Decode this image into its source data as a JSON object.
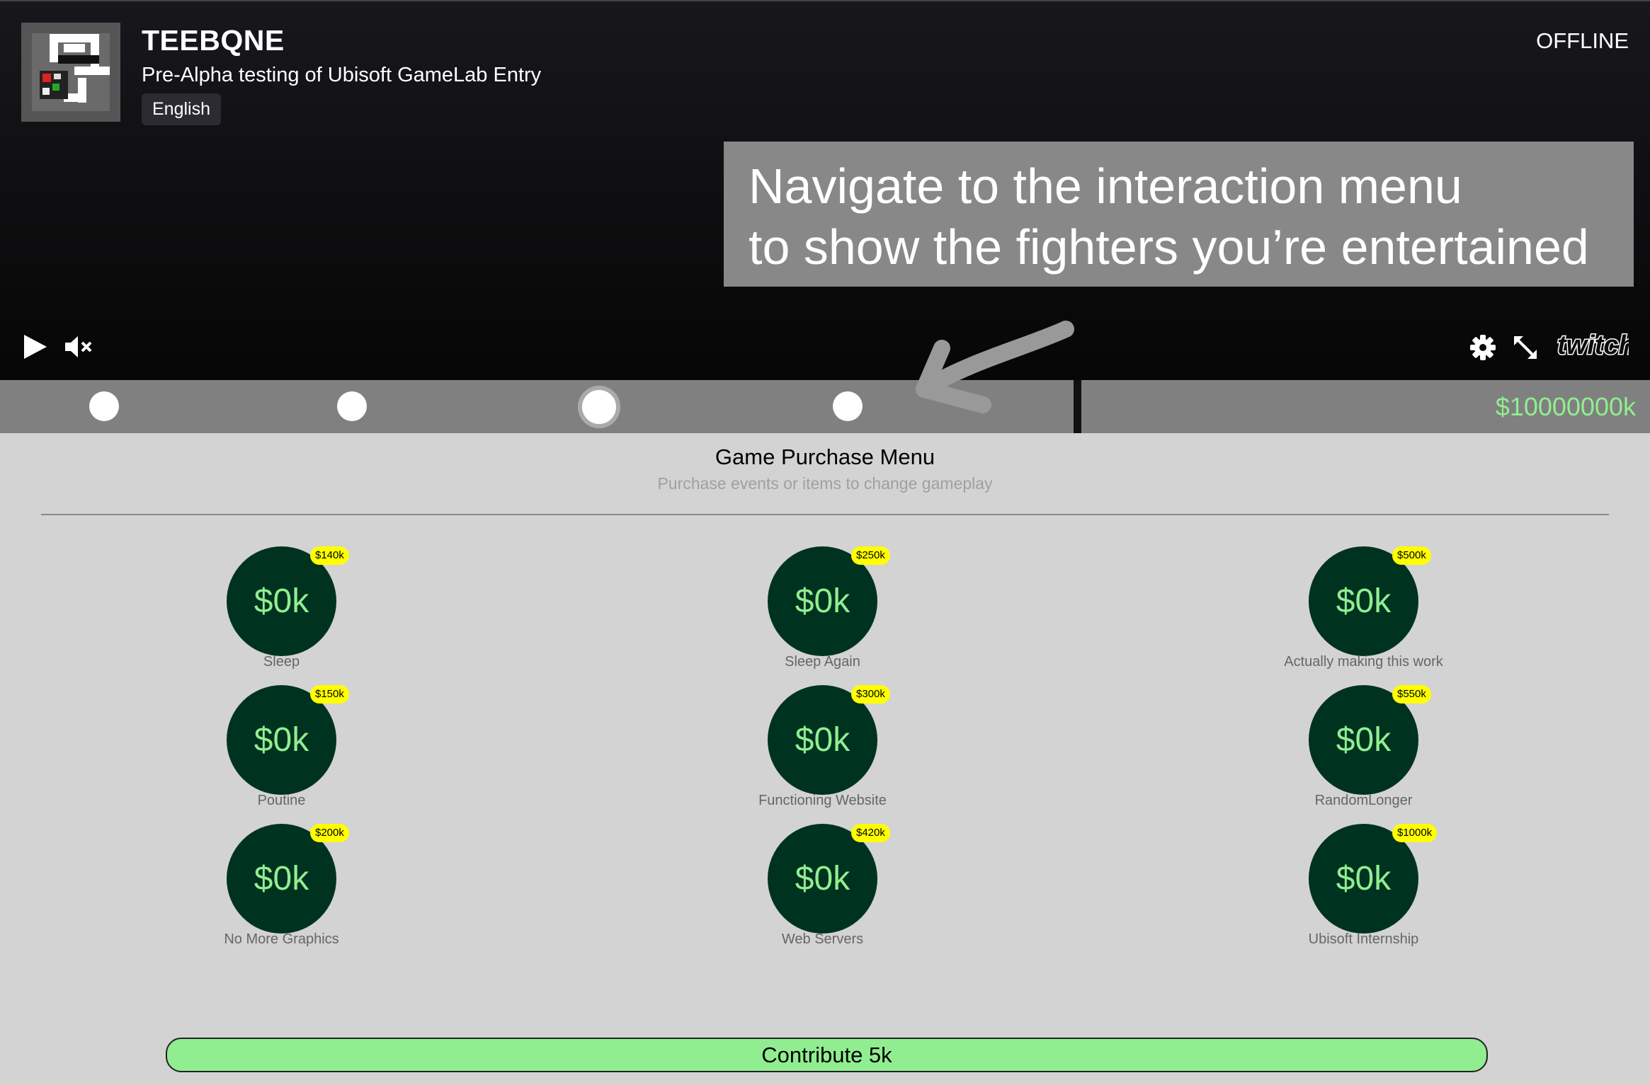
{
  "channel": {
    "name": "TEEBQNE",
    "title": "Pre-Alpha testing of Ubisoft GameLab Entry",
    "language": "English",
    "status": "OFFLINE"
  },
  "overlay": {
    "line1": "Navigate to the interaction menu",
    "line2": "to show the fighters you’re entertained"
  },
  "controls": {
    "play_icon": "play-icon",
    "mute_icon": "muted-speaker-icon",
    "settings_icon": "gear-icon",
    "fullscreen_icon": "expand-icon",
    "brand": "twitch"
  },
  "extension": {
    "balance": "$10000000k",
    "active_dot": 3,
    "dot_count": 4
  },
  "menu": {
    "title": "Game Purchase Menu",
    "subtitle": "Purchase events or items to change gameplay",
    "items": [
      {
        "value": "$0k",
        "price": "$140k",
        "label": "Sleep"
      },
      {
        "value": "$0k",
        "price": "$250k",
        "label": "Sleep Again"
      },
      {
        "value": "$0k",
        "price": "$500k",
        "label": "Actually making this work"
      },
      {
        "value": "$0k",
        "price": "$150k",
        "label": "Poutine"
      },
      {
        "value": "$0k",
        "price": "$300k",
        "label": "Functioning Website"
      },
      {
        "value": "$0k",
        "price": "$550k",
        "label": "RandomLonger"
      },
      {
        "value": "$0k",
        "price": "$200k",
        "label": "No More Graphics"
      },
      {
        "value": "$0k",
        "price": "$420k",
        "label": "Web Servers"
      },
      {
        "value": "$0k",
        "price": "$1000k",
        "label": "Ubisoft Internship"
      }
    ],
    "contribute_label": "Contribute 5k"
  },
  "colors": {
    "accent_green": "#90ee90",
    "coin_bg": "#003220",
    "price_tag": "#ffff00",
    "overlay_bg": "#888888"
  }
}
